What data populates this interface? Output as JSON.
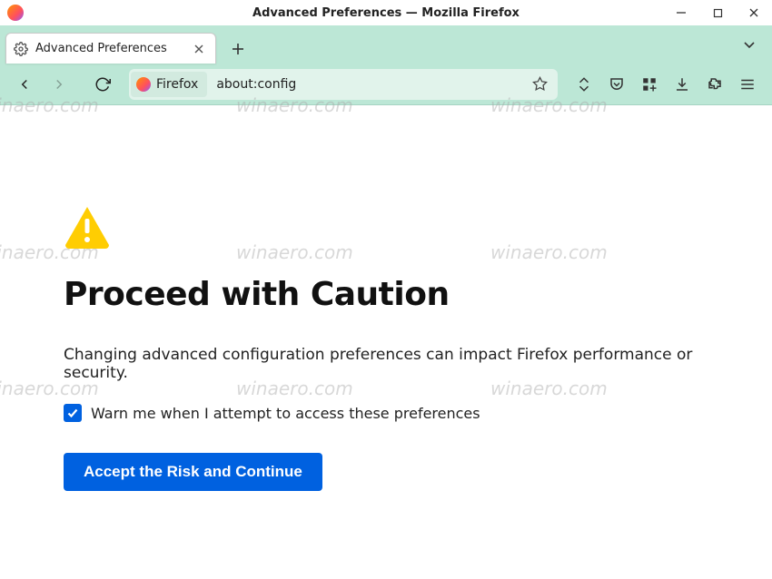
{
  "window": {
    "title": "Advanced Preferences — Mozilla Firefox"
  },
  "tab": {
    "title": "Advanced Preferences"
  },
  "urlbar": {
    "identity": "Firefox",
    "url": "about:config"
  },
  "page": {
    "headline": "Proceed with Caution",
    "description": "Changing advanced configuration preferences can impact Firefox performance or security.",
    "checkbox_label": "Warn me when I attempt to access these preferences",
    "checkbox_checked": true,
    "accept_button": "Accept the Risk and Continue"
  },
  "watermark": "winaero.com"
}
